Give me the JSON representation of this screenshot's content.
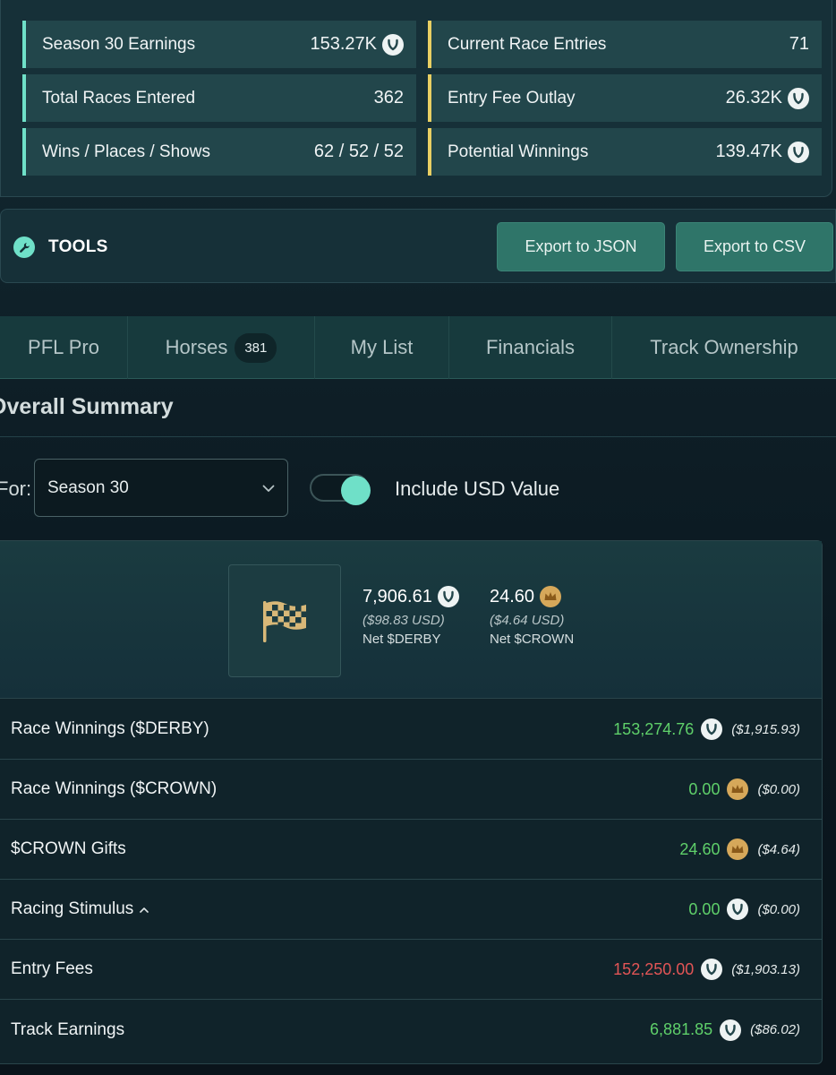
{
  "stats": {
    "left": [
      {
        "label": "Season 30 Earnings",
        "value": "153.27K",
        "icon": "horseshoe-icon"
      },
      {
        "label": "Total Races Entered",
        "value": "362"
      },
      {
        "label": "Wins / Places / Shows",
        "value": "62 / 52 / 52"
      }
    ],
    "right": [
      {
        "label": "Current Race Entries",
        "value": "71"
      },
      {
        "label": "Entry Fee Outlay",
        "value": "26.32K",
        "icon": "horseshoe-icon"
      },
      {
        "label": "Potential Winnings",
        "value": "139.47K",
        "icon": "horseshoe-icon"
      }
    ]
  },
  "tools": {
    "label": "TOOLS",
    "export_json": "Export to JSON",
    "export_csv": "Export to CSV"
  },
  "tabs": [
    {
      "label": "PFL Pro"
    },
    {
      "label": "Horses",
      "badge": "381"
    },
    {
      "label": "My List"
    },
    {
      "label": "Financials"
    },
    {
      "label": "Track Ownership"
    }
  ],
  "summary": {
    "title": "Overall Summary",
    "filter_label": "For:",
    "season_selected": "Season 30",
    "toggle_label": "Include USD Value",
    "toggle_on": true,
    "net_derby": {
      "amount": "7,906.61",
      "usd": "($98.83 USD)",
      "label": "Net $DERBY"
    },
    "net_crown": {
      "amount": "24.60",
      "usd": "($4.64 USD)",
      "label": "Net $CROWN"
    },
    "rows": [
      {
        "label": "Race Winnings ($DERBY)",
        "amount": "153,274.76",
        "usd": "($1,915.93)",
        "currency": "derby",
        "sign": "pos"
      },
      {
        "label": "Race Winnings ($CROWN)",
        "amount": "0.00",
        "usd": "($0.00)",
        "currency": "crown",
        "sign": "pos"
      },
      {
        "label": "$CROWN Gifts",
        "amount": "24.60",
        "usd": "($4.64)",
        "currency": "crown",
        "sign": "pos"
      },
      {
        "label": "Racing Stimulus",
        "amount": "0.00",
        "usd": "($0.00)",
        "currency": "derby",
        "sign": "pos",
        "expandable": true
      },
      {
        "label": "Entry Fees",
        "amount": "152,250.00",
        "usd": "($1,903.13)",
        "currency": "derby",
        "sign": "neg"
      },
      {
        "label": "Track Earnings",
        "amount": "6,881.85",
        "usd": "($86.02)",
        "currency": "derby",
        "sign": "pos"
      }
    ]
  },
  "colors": {
    "accent_teal": "#6fe0c8",
    "accent_gold": "#e9cf63",
    "positive": "#5fd06a",
    "negative": "#e25556",
    "button": "#2f7569"
  }
}
